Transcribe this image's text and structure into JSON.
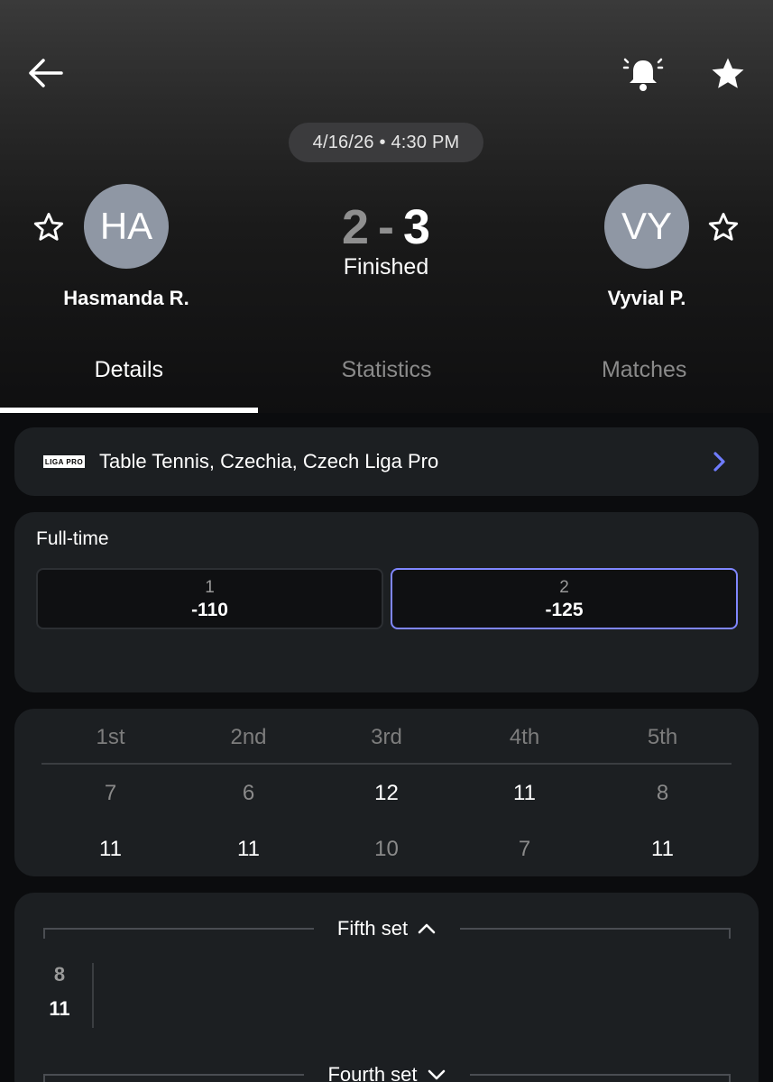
{
  "header": {
    "datetime": "4/16/26 • 4:30 PM",
    "icons": {
      "back": "arrow-left-icon",
      "bell": "bell-icon",
      "favorite": "star-filled-icon"
    }
  },
  "match": {
    "home": {
      "initials": "HA",
      "name": "Hasmanda R.",
      "score": "2"
    },
    "away": {
      "initials": "VY",
      "name": "Vyvial P.",
      "score": "3"
    },
    "separator": "-",
    "status": "Finished"
  },
  "tabs": [
    {
      "label": "Details",
      "active": true
    },
    {
      "label": "Statistics",
      "active": false
    },
    {
      "label": "Matches",
      "active": false
    }
  ],
  "league": {
    "logo_text": "LIGA PRO",
    "name": "Table Tennis, Czechia, Czech Liga Pro"
  },
  "fulltime": {
    "label": "Full-time",
    "odds": [
      {
        "label": "1",
        "value": "-110",
        "selected": false
      },
      {
        "label": "2",
        "value": "-125",
        "selected": true
      }
    ]
  },
  "sets": {
    "headers": [
      "1st",
      "2nd",
      "3rd",
      "4th",
      "5th"
    ],
    "home": [
      "7",
      "6",
      "12",
      "11",
      "8"
    ],
    "away": [
      "11",
      "11",
      "10",
      "7",
      "11"
    ]
  },
  "set_details": {
    "fifth": {
      "title": "Fifth set",
      "home_points": "8",
      "away_points": "11"
    },
    "fourth": {
      "title": "Fourth set"
    }
  },
  "colors": {
    "accent": "#7f86ff",
    "chevron": "#6f7cff",
    "avatar": "#8f97a4"
  }
}
